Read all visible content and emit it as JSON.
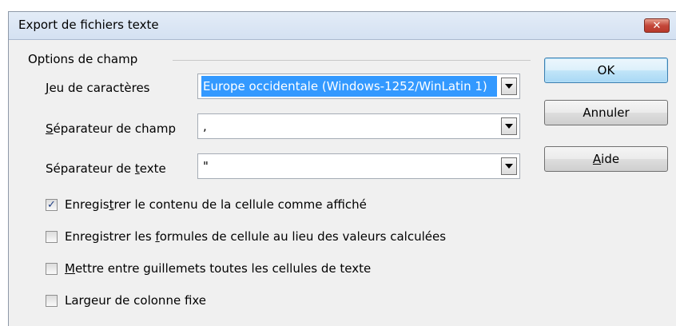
{
  "window": {
    "title": "Export de fichiers texte",
    "close_glyph": "✕"
  },
  "group": {
    "title": "Options de champ"
  },
  "fields": {
    "charset": {
      "label_pre": "",
      "label_mnemonic": "J",
      "label_post": "eu de caractères",
      "value": "Europe occidentale (Windows-1252/WinLatin 1)"
    },
    "field_sep": {
      "label_pre": "",
      "label_mnemonic": "S",
      "label_post": "éparateur de champ",
      "value": ","
    },
    "text_sep": {
      "label_pre": "Séparateur de ",
      "label_mnemonic": "t",
      "label_post": "exte",
      "value": "\""
    }
  },
  "checkboxes": [
    {
      "pre": "Enregis",
      "mnemonic": "t",
      "post": "rer le contenu de la cellule comme affiché",
      "checked": true,
      "mark": "✓"
    },
    {
      "pre": "Enregistrer les ",
      "mnemonic": "f",
      "post": "ormules de cellule au lieu des valeurs calculées",
      "checked": false,
      "mark": ""
    },
    {
      "pre": "",
      "mnemonic": "M",
      "post": "ettre entre guillemets toutes les cellules de texte",
      "checked": false,
      "mark": ""
    },
    {
      "pre": "Largeur de colonne f",
      "mnemonic": "i",
      "post": "xe",
      "checked": false,
      "mark": ""
    }
  ],
  "buttons": {
    "ok": {
      "label": "OK"
    },
    "cancel": {
      "label": "Annuler"
    },
    "help": {
      "pre": "",
      "mnemonic": "A",
      "post": "ide"
    }
  },
  "colors": {
    "selection": "#3399ff",
    "close_button": "#c4473a",
    "check_mark": "#1f3d83"
  }
}
